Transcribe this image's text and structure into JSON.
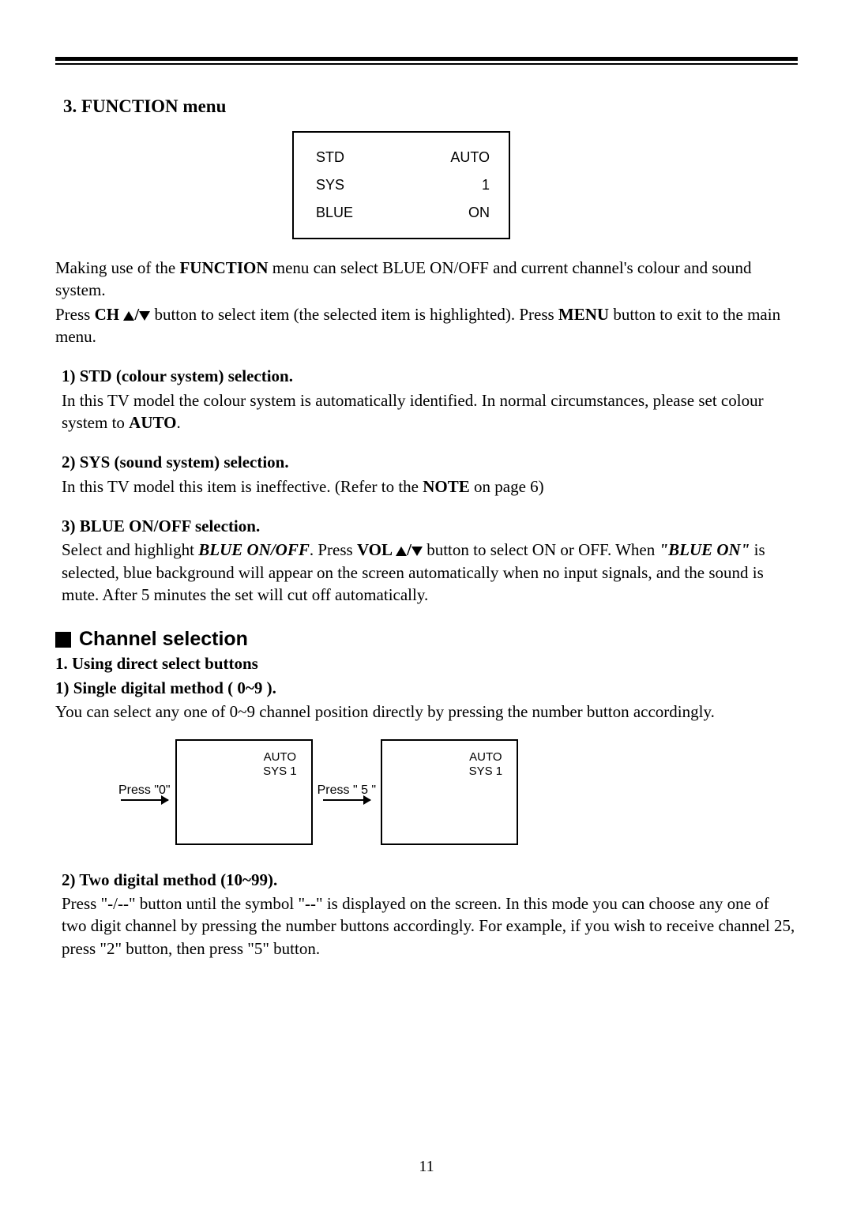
{
  "pageNumber": "11",
  "heading1": "3. FUNCTION menu",
  "menuBox": {
    "rows": [
      {
        "label": "STD",
        "value": "AUTO"
      },
      {
        "label": "SYS",
        "value": "1"
      },
      {
        "label": "BLUE",
        "value": "ON"
      }
    ]
  },
  "intro": {
    "line1a": "Making use of the ",
    "line1b": "FUNCTION",
    "line1c": " menu can select BLUE ON/OFF and current channel's colour and sound system.",
    "line2a": "Press ",
    "line2b": "CH ",
    "line2c": "/",
    "line2d": " button  to select item (the selected item is highlighted). Press ",
    "line2e": "MENU",
    "line2f": " button to exit to the main menu."
  },
  "s1": {
    "title": "1) STD (colour system) selection.",
    "body_a": "In this TV model the colour system is automatically identified. In normal circumstances, please set colour system to ",
    "body_b": "AUTO",
    "body_c": "."
  },
  "s2": {
    "title": "2) SYS (sound system) selection.",
    "body_a": "In this TV model this item is ineffective. (Refer to the ",
    "body_b": "NOTE",
    "body_c": " on page 6)"
  },
  "s3": {
    "title": "3) BLUE ON/OFF selection.",
    "body_a": "Select and highlight ",
    "body_b": "BLUE ON/OFF",
    "body_c": ". Press ",
    "body_d": "VOL ",
    "body_e": "/",
    "body_f": " button to select ON or OFF. When ",
    "body_g": "\"BLUE ON\"",
    "body_h": " is selected, blue background will appear on the screen automatically when no input signals, and the sound is mute. After 5 minutes the set will cut off automatically."
  },
  "channelSection": {
    "heading": "Channel selection",
    "sub1": "1. Using direct select buttons",
    "sub1a": "1) Single digital method ( 0~9 ).",
    "sub1a_body": "You can select any one of 0~9 channel position directly by pressing the number button accordingly.",
    "diagram": {
      "press0": "Press \"0\"",
      "press5": "Press \" 5 \"",
      "screenLine1": "AUTO",
      "screenLine2": "SYS 1"
    },
    "sub1b": "2) Two digital method (10~99).",
    "sub1b_body": "Press  \"-/--\" button until the symbol \"--\" is displayed on the screen. In this mode you can choose any one of two digit channel by pressing the number buttons accordingly. For example, if you wish to receive channel 25, press \"2\" button, then press \"5\" button."
  }
}
